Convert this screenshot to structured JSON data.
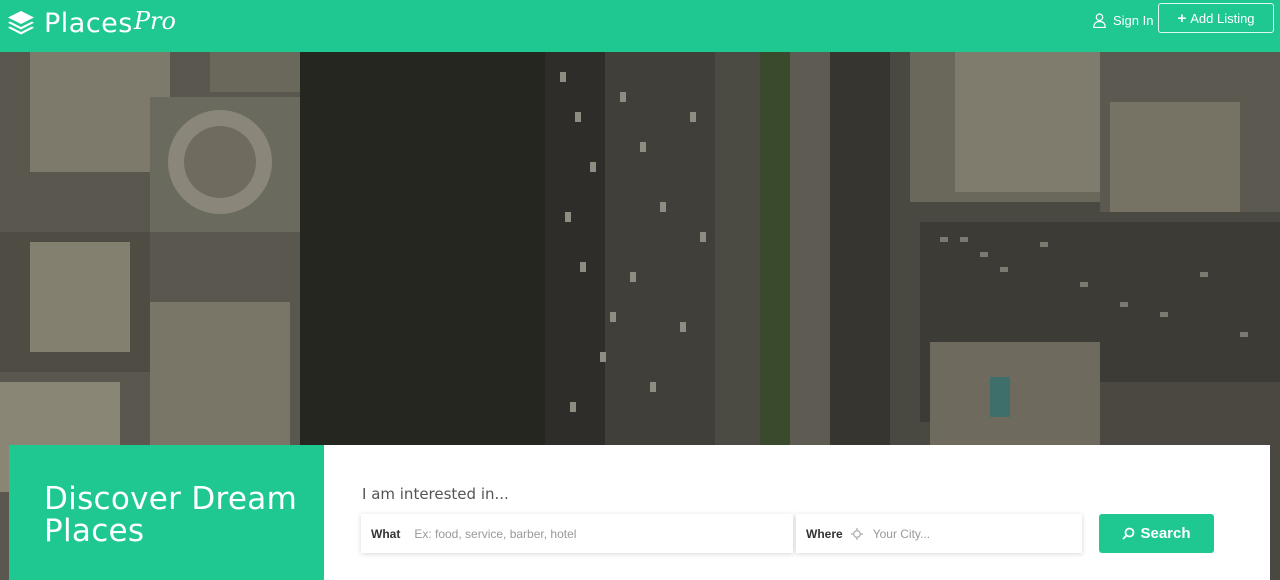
{
  "brand": {
    "name": "Places",
    "suffix": "Pro",
    "color": "#1fc891"
  },
  "header": {
    "sign_in": "Sign In",
    "add_listing": "Add Listing",
    "user_icon": "user-icon",
    "plus_icon": "plus-icon"
  },
  "hero": {
    "image": "aerial-city-photo"
  },
  "discover": {
    "title": "Discover Dream Places"
  },
  "search": {
    "intro": "I am interested in...",
    "what_label": "What",
    "what_placeholder": "Ex: food, service, barber, hotel",
    "where_label": "Where",
    "where_placeholder": "Your City...",
    "location_icon": "crosshair-icon",
    "button_label": "Search",
    "button_icon": "search-icon"
  }
}
